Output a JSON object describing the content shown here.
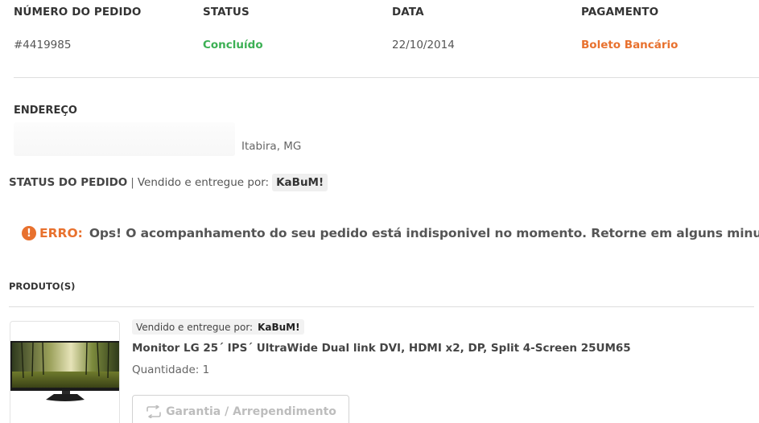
{
  "order": {
    "headers": {
      "number": "NÚMERO DO PEDIDO",
      "status": "STATUS",
      "date": "DATA",
      "payment": "PAGAMENTO"
    },
    "number": "#4419985",
    "status": "Concluído",
    "date": "22/10/2014",
    "payment": "Boleto Bancário"
  },
  "address": {
    "label": "ENDEREÇO",
    "city": "Itabira, MG"
  },
  "order_status": {
    "label": "STATUS DO PEDIDO",
    "separator": "|",
    "sold_by": "Vendido e entregue por:",
    "seller": "KaBuM!"
  },
  "error": {
    "icon": "exclamation-circle-icon",
    "label": "ERRO:",
    "message": "Ops! O acompanhamento do seu pedido está indisponivel no momento. Retorne em alguns minutos."
  },
  "products": {
    "label": "PRODUTO(S)",
    "items": [
      {
        "sold_by": "Vendido e entregue por:",
        "seller": "KaBuM!",
        "name": "Monitor LG 25´ IPS´ UltraWide Dual link DVI, HDMI x2, DP, Split 4-Screen 25UM65",
        "quantity": "Quantidade: 1",
        "image": "monitor-image",
        "warranty_button": "Garantia / Arrependimento"
      }
    ]
  },
  "colors": {
    "success": "#3cb054",
    "accent": "#e8712e"
  }
}
